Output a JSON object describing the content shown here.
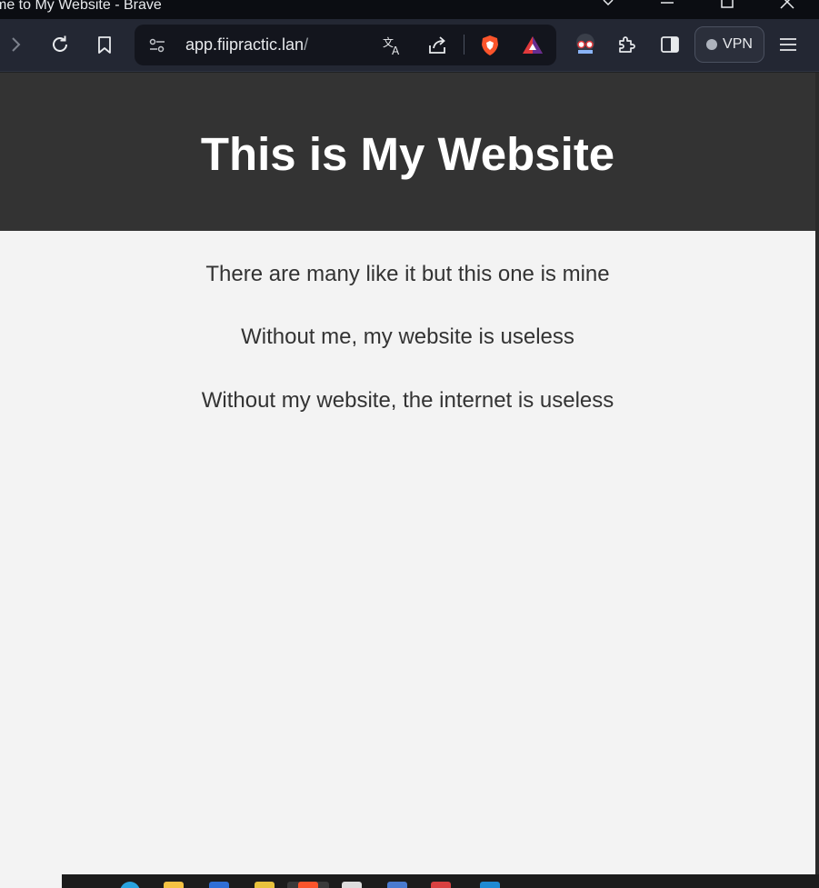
{
  "window": {
    "title": "me to My Website - Brave"
  },
  "browser": {
    "url_host": "app.fiipractic.lan",
    "url_path": "/",
    "vpn_label": "VPN"
  },
  "page": {
    "heading": "This is My Website",
    "paragraphs": [
      "There are many like it but this one is mine",
      "Without me, my website is useless",
      "Without my website, the internet is useless"
    ]
  },
  "colors": {
    "header_bg": "#333333",
    "page_bg": "#f3f3f3",
    "toolbar_bg": "#232733",
    "brave_orange": "#fb542b"
  }
}
